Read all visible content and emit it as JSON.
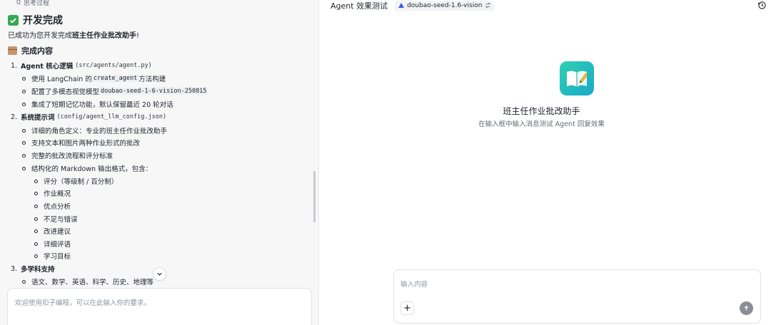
{
  "left": {
    "thinking_label": "思考过程",
    "done_title": "开发完成",
    "success_prefix": "已成功为您开发完成",
    "success_name": "班主任作业批改助手",
    "success_suffix": "!",
    "section_title": "完成内容",
    "items": [
      {
        "num": "1.",
        "title": "Agent 核心逻辑",
        "path": "(src/agents/agent.py)"
      },
      {
        "num": "2.",
        "title": "系统提示词",
        "path": "(config/agent_llm_config.json)"
      },
      {
        "num": "3.",
        "title": "多学科支持",
        "path": ""
      }
    ],
    "sub1": [
      {
        "pre": "使用 LangChain 的 ",
        "code": "create_agent",
        "post": " 方法构建"
      },
      {
        "pre": "配置了多模态视觉模型 ",
        "code": "doubao-seed-1-6-vision-250815",
        "post": ""
      },
      {
        "pre": "集成了短期记忆功能，默认保留最近 20 轮对话",
        "code": "",
        "post": ""
      }
    ],
    "sub2": [
      "详细的角色定义：专业的班主任作业批改助手",
      "支持文本和图片两种作业形式的批改",
      "完整的批改流程和评分标准",
      "结构化的 Markdown 输出格式，包含："
    ],
    "sub2_nested": [
      "评分（等级制 / 百分制）",
      "作业概况",
      "优点分析",
      "不足与错误",
      "改进建议",
      "详细评语",
      "学习目标"
    ],
    "sub3": [
      "语文、数学、英语、科学、历史、地理等"
    ],
    "input_placeholder": "欢迎使用扣子编程，可以在此输入你的要求。"
  },
  "right": {
    "header_title": "Agent 效果测试",
    "model_name": "doubao-seed-1.6-vision",
    "agent_name": "班主任作业批改助手",
    "agent_hint": "在输入框中输入消息测试 Agent 回复效果",
    "input_placeholder": "输入内容",
    "plus_label": "+"
  },
  "colors": {
    "accent_green": "#34a853",
    "logo_gradient_start": "#2fd0b1",
    "logo_gradient_end": "#1aa9c9",
    "send_button": "#8a8f96"
  },
  "icons": [
    "lightbulb-icon",
    "check-icon",
    "package-icon",
    "chevron-down-icon",
    "model-logo-icon",
    "swap-icon",
    "history-icon",
    "agent-book-icon",
    "plus-icon",
    "send-arrow-icon"
  ]
}
